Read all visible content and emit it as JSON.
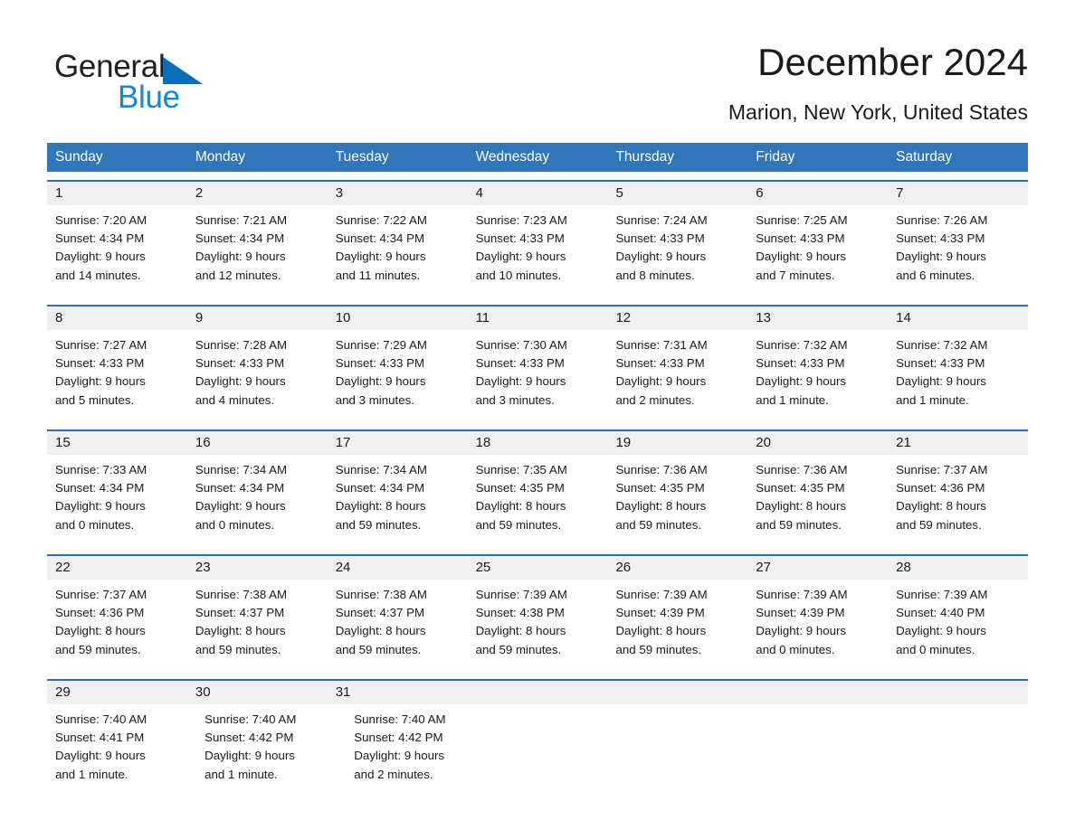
{
  "brand": {
    "name_part1": "General",
    "name_part2": "Blue",
    "triangle_color": "#0b6cb7",
    "blue_text_color": "#1a84d6"
  },
  "header": {
    "title": "December 2024",
    "subtitle": "Marion, New York, United States"
  },
  "theme": {
    "header_blue": "#3076b9",
    "row_divider_blue": "#2f6fae",
    "date_band_gray": "#f0f0f0",
    "text_color": "#1a1a1a"
  },
  "calendar": {
    "weekday_headers": [
      "Sunday",
      "Monday",
      "Tuesday",
      "Wednesday",
      "Thursday",
      "Friday",
      "Saturday"
    ],
    "weeks": [
      {
        "days": [
          {
            "date": "1",
            "sunrise": "Sunrise: 7:20 AM",
            "sunset": "Sunset: 4:34 PM",
            "daylight_line1": "Daylight: 9 hours",
            "daylight_line2": "and 14 minutes."
          },
          {
            "date": "2",
            "sunrise": "Sunrise: 7:21 AM",
            "sunset": "Sunset: 4:34 PM",
            "daylight_line1": "Daylight: 9 hours",
            "daylight_line2": "and 12 minutes."
          },
          {
            "date": "3",
            "sunrise": "Sunrise: 7:22 AM",
            "sunset": "Sunset: 4:34 PM",
            "daylight_line1": "Daylight: 9 hours",
            "daylight_line2": "and 11 minutes."
          },
          {
            "date": "4",
            "sunrise": "Sunrise: 7:23 AM",
            "sunset": "Sunset: 4:33 PM",
            "daylight_line1": "Daylight: 9 hours",
            "daylight_line2": "and 10 minutes."
          },
          {
            "date": "5",
            "sunrise": "Sunrise: 7:24 AM",
            "sunset": "Sunset: 4:33 PM",
            "daylight_line1": "Daylight: 9 hours",
            "daylight_line2": "and 8 minutes."
          },
          {
            "date": "6",
            "sunrise": "Sunrise: 7:25 AM",
            "sunset": "Sunset: 4:33 PM",
            "daylight_line1": "Daylight: 9 hours",
            "daylight_line2": "and 7 minutes."
          },
          {
            "date": "7",
            "sunrise": "Sunrise: 7:26 AM",
            "sunset": "Sunset: 4:33 PM",
            "daylight_line1": "Daylight: 9 hours",
            "daylight_line2": "and 6 minutes."
          }
        ]
      },
      {
        "days": [
          {
            "date": "8",
            "sunrise": "Sunrise: 7:27 AM",
            "sunset": "Sunset: 4:33 PM",
            "daylight_line1": "Daylight: 9 hours",
            "daylight_line2": "and 5 minutes."
          },
          {
            "date": "9",
            "sunrise": "Sunrise: 7:28 AM",
            "sunset": "Sunset: 4:33 PM",
            "daylight_line1": "Daylight: 9 hours",
            "daylight_line2": "and 4 minutes."
          },
          {
            "date": "10",
            "sunrise": "Sunrise: 7:29 AM",
            "sunset": "Sunset: 4:33 PM",
            "daylight_line1": "Daylight: 9 hours",
            "daylight_line2": "and 3 minutes."
          },
          {
            "date": "11",
            "sunrise": "Sunrise: 7:30 AM",
            "sunset": "Sunset: 4:33 PM",
            "daylight_line1": "Daylight: 9 hours",
            "daylight_line2": "and 3 minutes."
          },
          {
            "date": "12",
            "sunrise": "Sunrise: 7:31 AM",
            "sunset": "Sunset: 4:33 PM",
            "daylight_line1": "Daylight: 9 hours",
            "daylight_line2": "and 2 minutes."
          },
          {
            "date": "13",
            "sunrise": "Sunrise: 7:32 AM",
            "sunset": "Sunset: 4:33 PM",
            "daylight_line1": "Daylight: 9 hours",
            "daylight_line2": "and 1 minute."
          },
          {
            "date": "14",
            "sunrise": "Sunrise: 7:32 AM",
            "sunset": "Sunset: 4:33 PM",
            "daylight_line1": "Daylight: 9 hours",
            "daylight_line2": "and 1 minute."
          }
        ]
      },
      {
        "days": [
          {
            "date": "15",
            "sunrise": "Sunrise: 7:33 AM",
            "sunset": "Sunset: 4:34 PM",
            "daylight_line1": "Daylight: 9 hours",
            "daylight_line2": "and 0 minutes."
          },
          {
            "date": "16",
            "sunrise": "Sunrise: 7:34 AM",
            "sunset": "Sunset: 4:34 PM",
            "daylight_line1": "Daylight: 9 hours",
            "daylight_line2": "and 0 minutes."
          },
          {
            "date": "17",
            "sunrise": "Sunrise: 7:34 AM",
            "sunset": "Sunset: 4:34 PM",
            "daylight_line1": "Daylight: 8 hours",
            "daylight_line2": "and 59 minutes."
          },
          {
            "date": "18",
            "sunrise": "Sunrise: 7:35 AM",
            "sunset": "Sunset: 4:35 PM",
            "daylight_line1": "Daylight: 8 hours",
            "daylight_line2": "and 59 minutes."
          },
          {
            "date": "19",
            "sunrise": "Sunrise: 7:36 AM",
            "sunset": "Sunset: 4:35 PM",
            "daylight_line1": "Daylight: 8 hours",
            "daylight_line2": "and 59 minutes."
          },
          {
            "date": "20",
            "sunrise": "Sunrise: 7:36 AM",
            "sunset": "Sunset: 4:35 PM",
            "daylight_line1": "Daylight: 8 hours",
            "daylight_line2": "and 59 minutes."
          },
          {
            "date": "21",
            "sunrise": "Sunrise: 7:37 AM",
            "sunset": "Sunset: 4:36 PM",
            "daylight_line1": "Daylight: 8 hours",
            "daylight_line2": "and 59 minutes."
          }
        ]
      },
      {
        "days": [
          {
            "date": "22",
            "sunrise": "Sunrise: 7:37 AM",
            "sunset": "Sunset: 4:36 PM",
            "daylight_line1": "Daylight: 8 hours",
            "daylight_line2": "and 59 minutes."
          },
          {
            "date": "23",
            "sunrise": "Sunrise: 7:38 AM",
            "sunset": "Sunset: 4:37 PM",
            "daylight_line1": "Daylight: 8 hours",
            "daylight_line2": "and 59 minutes."
          },
          {
            "date": "24",
            "sunrise": "Sunrise: 7:38 AM",
            "sunset": "Sunset: 4:37 PM",
            "daylight_line1": "Daylight: 8 hours",
            "daylight_line2": "and 59 minutes."
          },
          {
            "date": "25",
            "sunrise": "Sunrise: 7:39 AM",
            "sunset": "Sunset: 4:38 PM",
            "daylight_line1": "Daylight: 8 hours",
            "daylight_line2": "and 59 minutes."
          },
          {
            "date": "26",
            "sunrise": "Sunrise: 7:39 AM",
            "sunset": "Sunset: 4:39 PM",
            "daylight_line1": "Daylight: 8 hours",
            "daylight_line2": "and 59 minutes."
          },
          {
            "date": "27",
            "sunrise": "Sunrise: 7:39 AM",
            "sunset": "Sunset: 4:39 PM",
            "daylight_line1": "Daylight: 9 hours",
            "daylight_line2": "and 0 minutes."
          },
          {
            "date": "28",
            "sunrise": "Sunrise: 7:39 AM",
            "sunset": "Sunset: 4:40 PM",
            "daylight_line1": "Daylight: 9 hours",
            "daylight_line2": "and 0 minutes."
          }
        ]
      },
      {
        "days": [
          {
            "date": "29",
            "sunrise": "Sunrise: 7:40 AM",
            "sunset": "Sunset: 4:41 PM",
            "daylight_line1": "Daylight: 9 hours",
            "daylight_line2": "and 1 minute."
          },
          {
            "date": "30",
            "sunrise": "Sunrise: 7:40 AM",
            "sunset": "Sunset: 4:42 PM",
            "daylight_line1": "Daylight: 9 hours",
            "daylight_line2": "and 1 minute."
          },
          {
            "date": "31",
            "sunrise": "Sunrise: 7:40 AM",
            "sunset": "Sunset: 4:42 PM",
            "daylight_line1": "Daylight: 9 hours",
            "daylight_line2": "and 2 minutes."
          },
          {
            "date": "",
            "sunrise": "",
            "sunset": "",
            "daylight_line1": "",
            "daylight_line2": ""
          },
          {
            "date": "",
            "sunrise": "",
            "sunset": "",
            "daylight_line1": "",
            "daylight_line2": ""
          },
          {
            "date": "",
            "sunrise": "",
            "sunset": "",
            "daylight_line1": "",
            "daylight_line2": ""
          },
          {
            "date": "",
            "sunrise": "",
            "sunset": "",
            "daylight_line1": "",
            "daylight_line2": ""
          }
        ]
      }
    ]
  }
}
